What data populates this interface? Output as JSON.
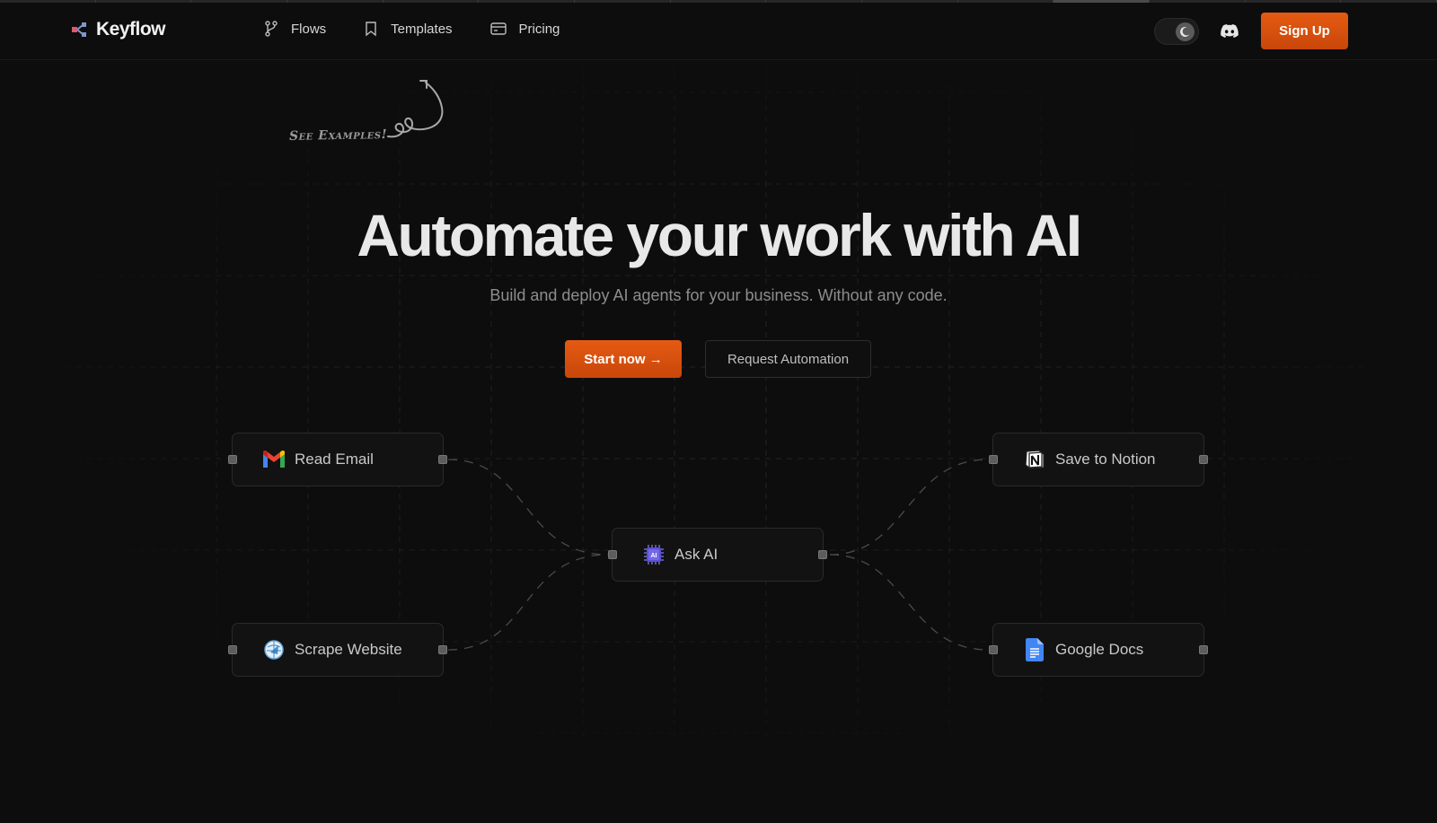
{
  "brand": {
    "name": "Keyflow",
    "accent": "#e0550f"
  },
  "nav": {
    "links": [
      {
        "label": "Flows",
        "icon": "git-branch-icon"
      },
      {
        "label": "Templates",
        "icon": "bookmark-icon"
      },
      {
        "label": "Pricing",
        "icon": "credit-card-icon"
      }
    ],
    "theme_toggle": {
      "icon": "moon-icon",
      "state": "dark"
    },
    "discord_icon": "discord-icon",
    "signup_label": "Sign Up"
  },
  "hero": {
    "annotation": "See Examples!",
    "title": "Automate your work with AI",
    "subtitle": "Build and deploy AI agents for your business. Without any code.",
    "primary_cta": "Start now →",
    "secondary_cta": "Request Automation"
  },
  "flow": {
    "nodes": [
      {
        "id": "read-email",
        "label": "Read Email",
        "icon": "gmail-icon"
      },
      {
        "id": "scrape-website",
        "label": "Scrape Website",
        "icon": "globe-scraper-icon"
      },
      {
        "id": "ask-ai",
        "label": "Ask AI",
        "icon": "ai-chip-icon"
      },
      {
        "id": "save-to-notion",
        "label": "Save to Notion",
        "icon": "notion-icon"
      },
      {
        "id": "google-docs",
        "label": "Google Docs",
        "icon": "google-docs-icon"
      }
    ],
    "edges": [
      [
        "read-email",
        "ask-ai"
      ],
      [
        "scrape-website",
        "ask-ai"
      ],
      [
        "ask-ai",
        "save-to-notion"
      ],
      [
        "ask-ai",
        "google-docs"
      ]
    ]
  }
}
